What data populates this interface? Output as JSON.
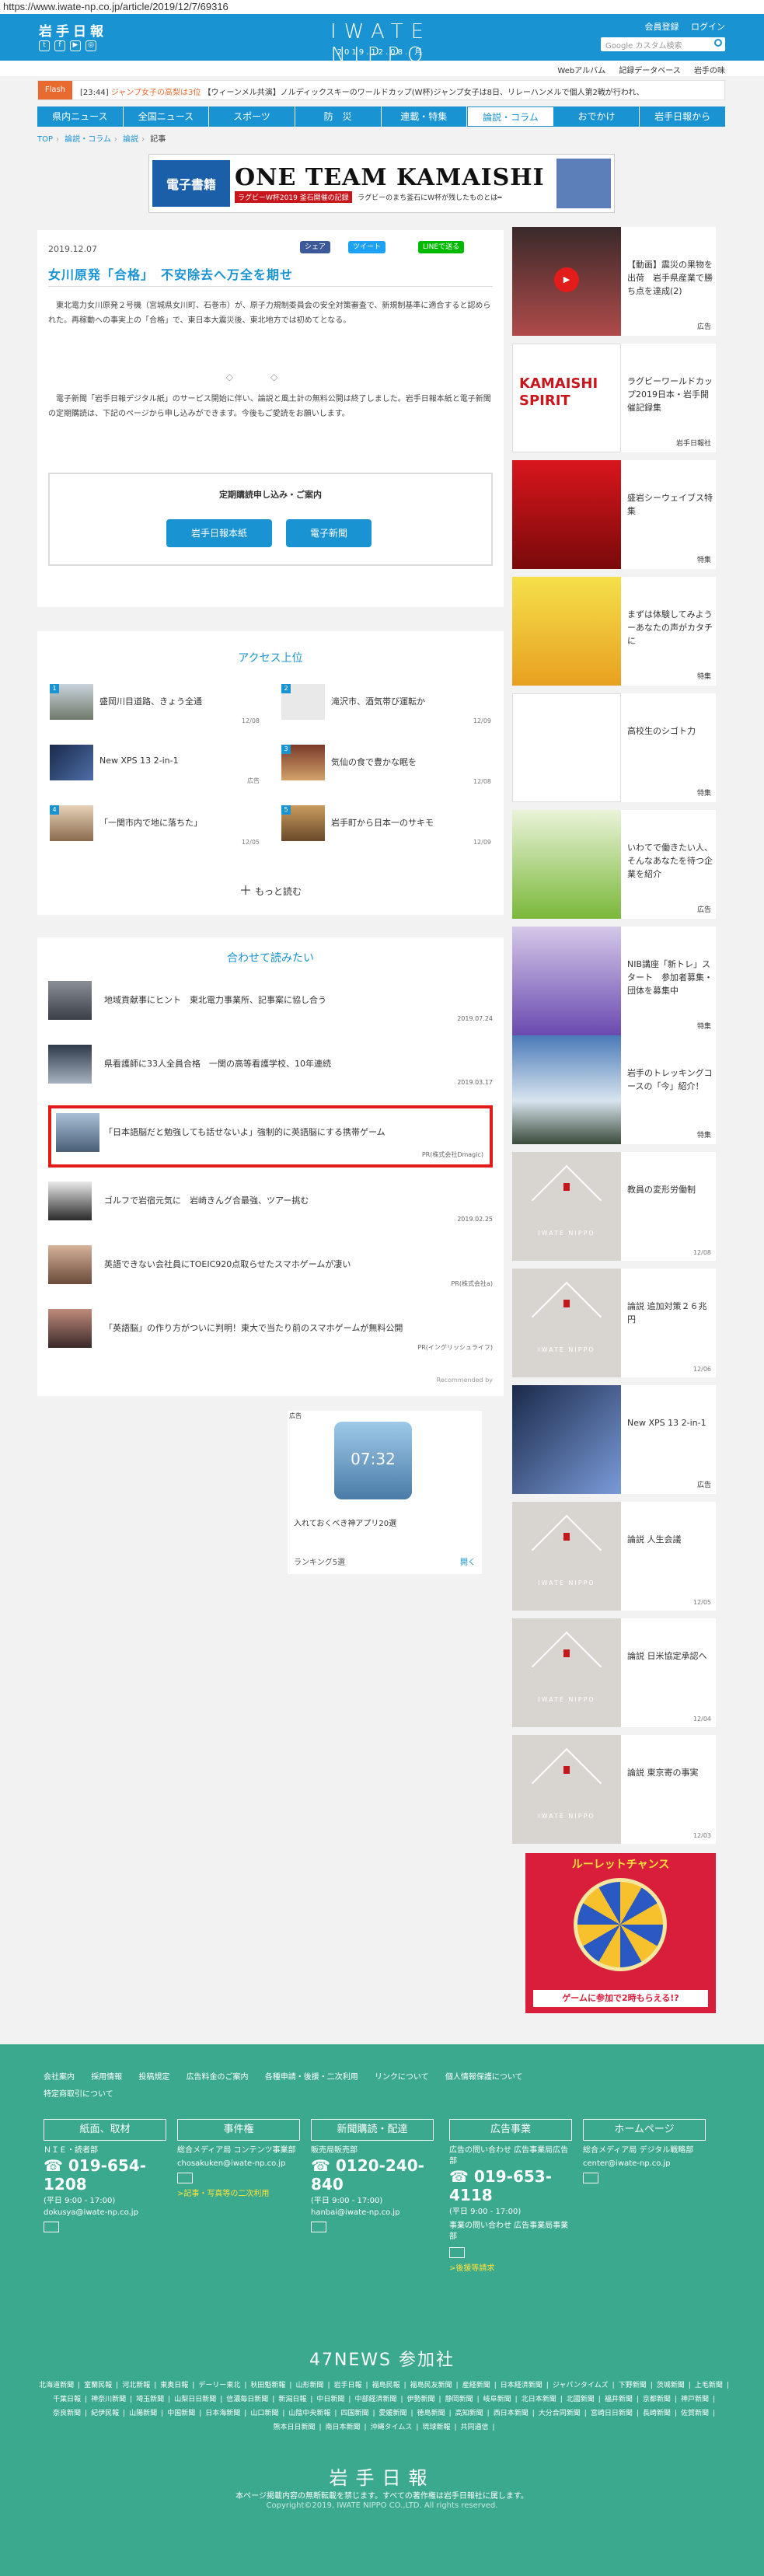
{
  "browser": {
    "url": "https://www.iwate-np.co.jp/article/2019/12/7/69316"
  },
  "header": {
    "logo": "岩手日報",
    "center_logo": "IWATE NIPPO",
    "date": "2019.12.08. 月",
    "member_register": "会員登録",
    "login": "ログイン",
    "search_placeholder": "Google カスタム検索"
  },
  "sub_links": [
    "Webアルバム",
    "記録データベース",
    "岩手の味"
  ],
  "flash": {
    "tag": "Flash",
    "time": "[23:44]",
    "text": "ジャンプ女子の高梨は3位",
    "more": "【ウィーンメル共演】ノルディックスキーのワールドカップ(W杯)ジャンプ女子は8日、リレーハンメルで個人第2戦が行われ、"
  },
  "gnav": [
    "県内ニュース",
    "全国ニュース",
    "スポーツ",
    "防　災",
    "連載・特集",
    "論説・コラム",
    "おでかけ",
    "岩手日報から"
  ],
  "gnav_active": 5,
  "breadcrumb": [
    "TOP",
    "論説・コラム",
    "論説",
    "記事"
  ],
  "top_banner": {
    "left": "電子書籍",
    "title": "ONE TEAM KAMAISHI",
    "sub": "ラグビーW杯2019 釜石開催の記録",
    "tag": "ラグビーのまち釜石にW杯が残したものとは━"
  },
  "article": {
    "date": "2019.12.07",
    "share_facebook": "シェア",
    "share_twitter": "ツイート",
    "share_line": "LINEで送る",
    "title": "女川原発「合格」　不安除去へ万全を期せ",
    "body": "　東北電力女川原発２号機（宮城県女川町、石巻市）が、原子力規制委員会の安全対策審査で、新規制基準に適合すると認められた。再稼動への事実上の「合格」で、東日本大震災後、東北地方では初めてとなる。",
    "diamonds": "◇◇",
    "body2": "　電子新聞「岩手日報デジタル紙」のサービス開始に伴い、論説と風土計の無料公開は終了しました。岩手日報本紙と電子新聞の定期購読は、下記のページから申し込みができます。今後もご愛読をお願いします。",
    "subscribe_title": "定期購読申し込み・ご案内",
    "btn_paper": "岩手日報本紙",
    "btn_digital": "電子新聞"
  },
  "access": {
    "title": "アクセス上位",
    "items": [
      {
        "title": "盛岡川目道路、きょう全通",
        "date": "12/08"
      },
      {
        "title": "滝沢市、酒気帯び運転か",
        "date": "12/09"
      },
      {
        "title": "New XPS 13 2-in-1",
        "date": "広告"
      },
      {
        "title": "気仙の食で豊かな眠を",
        "date": "12/08"
      },
      {
        "title": "「一関市内で地に落ちた」",
        "date": "12/05"
      },
      {
        "title": "岩手町から日本一のサキモ",
        "date": "12/09"
      }
    ],
    "more": "もっと読む"
  },
  "related": {
    "title": "合わせて読みたい",
    "items": [
      {
        "title": "地域貢献事にヒント　東北電力事業所、記事案に協し合う",
        "date": "2019.07.24"
      },
      {
        "title": "県看護師に33人全員合格　一関の高等看護学校、10年連続",
        "date": "2019.03.17"
      },
      {
        "title": "「日本語脳だと勉強しても話せないよ」強制的に英語脳にする携帯ゲーム",
        "date": "PR(株式会社Dmagic)"
      },
      {
        "title": "ゴルフで岩宿元気に　岩崎きんグ合最強、ツアー挑む",
        "date": "2019.02.25"
      },
      {
        "title": "英語できない会社員にTOEIC920点取らせたスマホゲームが凄い",
        "date": "PR(株式会社a)"
      },
      {
        "title": "「英語脳」の作り方がついに判明！東大で当たり前のスマホゲームが無料公開",
        "date": "PR(イングリッシュライフ)"
      }
    ],
    "recommended": "Recommended by"
  },
  "mid_ad": {
    "tag": "広告",
    "time": "07:32",
    "caption": "入れておくべき神アプリ20選",
    "footer": "ランキング5選",
    "open": "開く"
  },
  "sidebar": [
    {
      "title": "【動画】震災の果物を出荷　岩手県産業で勝ち点を達成(2)",
      "label": "広告"
    },
    {
      "title": "ラグビーワールドカップ2019日本・岩手開催記録集",
      "label": "岩手日報社"
    },
    {
      "title": "盛岩シーウェイブス特集",
      "label": "特集"
    },
    {
      "title": "まずは体験してみようーあなたの声がカタチに",
      "label": "特集"
    },
    {
      "title": "高校生のシゴト力",
      "label": "特集"
    },
    {
      "title": "いわてで働きたい人、そんなあなたを待つ企業を紹介",
      "label": "広告"
    },
    {
      "title": "NIB講座「新トレ」スタート　参加者募集・団体を募集中",
      "label": "特集"
    },
    {
      "title": "岩手のトレッキングコースの「今」紹介！",
      "label": "特集"
    },
    {
      "title": "教員の変形労働制",
      "label": "12/08"
    },
    {
      "title": "論説 追加対策２６兆円",
      "label": "12/06"
    },
    {
      "title": "New XPS 13 2-in-1",
      "label": "広告"
    },
    {
      "title": "論説 人生会議",
      "label": "12/05"
    },
    {
      "title": "論説 日米協定承認へ",
      "label": "12/04"
    },
    {
      "title": "論説 東京寄の事実",
      "label": "12/03"
    }
  ],
  "roulette": {
    "title": "ルーレットチャンス",
    "bottom": "ゲームに参加で2時もらえる!?"
  },
  "footer": {
    "links": [
      "会社案内",
      "採用情報",
      "投稿規定",
      "広告料金のご案内",
      "各種申請・後援・二次利用",
      "リンクについて",
      "個人情報保護について",
      "特定商取引について"
    ],
    "cols": [
      {
        "head": "紙面、取材",
        "label": "ＮＩＥ・読者部",
        "tel": "019-654-1208",
        "hours": "(平日 9:00 - 17:00)",
        "mail": "dokusya@iwate-np.co.jp"
      },
      {
        "head": "事件権",
        "label": "総合メディア局 コンテンツ事業部",
        "tel": "",
        "hours": "",
        "mail": "chosakuken@iwate-np.co.jp",
        "extra": ">記事・写真等の二次利用"
      },
      {
        "head": "新聞購読・配達",
        "label": "販売局販売部",
        "tel": "0120-240-840",
        "hours": "(平日 9:00 - 17:00)",
        "mail": "hanbai@iwate-np.co.jp"
      },
      {
        "head": "広告事業",
        "label": "広告の問い合わせ 広告事業局広告部",
        "tel": "019-653-4118",
        "hours": "(平日 9:00 - 17:00)",
        "mail": "事業の問い合わせ 広告事業局事業部",
        "extra": ">後援等請求"
      },
      {
        "head": "ホームページ",
        "label": "総合メディア局 デジタル戦略部",
        "tel": "",
        "hours": "",
        "mail": "center@iwate-np.co.jp"
      }
    ],
    "n47": "47NEWS 参加社",
    "papers": [
      "北海道新聞",
      "室蘭民報",
      "河北新報",
      "東奥日報",
      "デーリー東北",
      "秋田魁新報",
      "山形新聞",
      "岩手日報",
      "福島民報",
      "福島民友新聞",
      "産経新聞",
      "日本経済新聞",
      "ジャパンタイムズ",
      "下野新聞",
      "茨城新聞",
      "上毛新聞",
      "千葉日報",
      "神奈川新聞",
      "埼玉新聞",
      "山梨日日新聞",
      "信濃毎日新聞",
      "新潟日報",
      "中日新聞",
      "中部経済新聞",
      "伊勢新聞",
      "静岡新聞",
      "岐阜新聞",
      "北日本新聞",
      "北國新聞",
      "福井新聞",
      "京都新聞",
      "神戸新聞",
      "奈良新聞",
      "紀伊民報",
      "山陽新聞",
      "中国新聞",
      "日本海新聞",
      "山口新聞",
      "山陰中央新報",
      "四国新聞",
      "愛媛新聞",
      "徳島新聞",
      "高知新聞",
      "西日本新聞",
      "大分合同新聞",
      "宮崎日日新聞",
      "長崎新聞",
      "佐賀新聞",
      "熊本日日新聞",
      "南日本新聞",
      "沖縄タイムス",
      "琉球新報",
      "共同通信"
    ],
    "logo": "岩手日報",
    "note": "本ページ掲載内容の無断転載を禁じます。すべての著作権は岩手日報社に属します。",
    "copy": "Copyright©2019, IWATE NIPPO CO.,LTD. All rights reserved."
  }
}
